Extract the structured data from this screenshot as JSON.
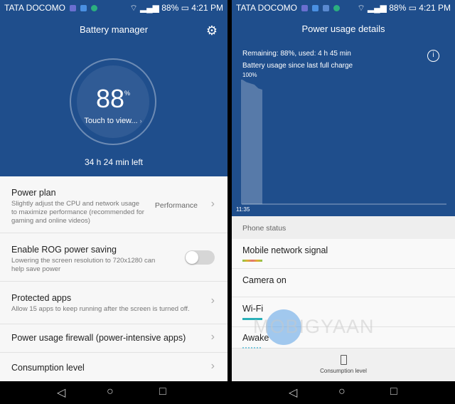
{
  "status": {
    "carrier": "TATA DOCOMO",
    "battery": "88%",
    "time": "4:21 PM"
  },
  "left": {
    "title": "Battery manager",
    "percent": "88",
    "percent_sign": "%",
    "touch": "Touch to view...",
    "time_left": "34 h 24 min left",
    "items": [
      {
        "title": "Power plan",
        "subtitle": "Slightly adjust the CPU and network usage to maximize performance (recommended for gaming and online videos)",
        "value": "Performance"
      },
      {
        "title": "Enable ROG power saving",
        "subtitle": "Lowering the screen resolution to 720x1280 can help save power",
        "toggle": false
      },
      {
        "title": "Protected apps",
        "subtitle": "Allow 15 apps to keep running after the screen is turned off."
      },
      {
        "title": "Power usage firewall (power-intensive apps)"
      },
      {
        "title": "Consumption level"
      }
    ]
  },
  "right": {
    "title": "Power usage details",
    "remaining": "Remaining: 88%, used: 4 h 45 min",
    "chart_label": "Battery usage since last full charge",
    "y_label": "100%",
    "x_label": "11:35",
    "chart_levels": [
      100,
      98,
      97,
      96,
      93,
      92
    ],
    "section": "Phone status",
    "items": [
      {
        "label": "Mobile network signal",
        "bar_color": "#e0b030"
      },
      {
        "label": "Camera on"
      },
      {
        "label": "Wi-Fi",
        "bar_color": "#2ab0b8"
      },
      {
        "label": "Awake",
        "bar_color": "#7cc8dc"
      }
    ],
    "bottom": "Consumption level"
  },
  "watermark": "MOBIGYAAN",
  "colors": {
    "header": "#1f4e8c"
  }
}
